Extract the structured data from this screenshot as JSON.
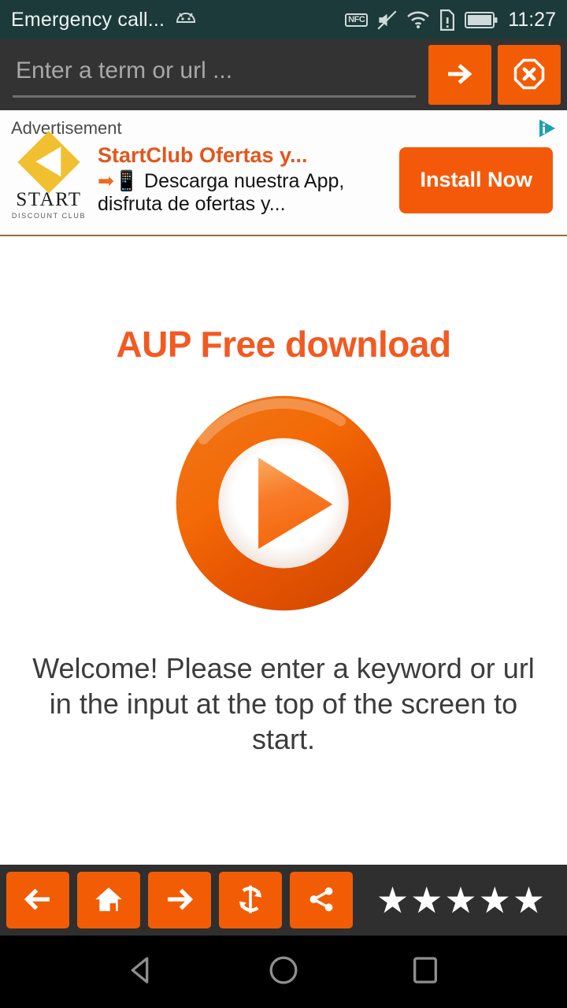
{
  "statusbar": {
    "title": "Emergency call...",
    "android_icon": "android-robot-icon",
    "nfc_label": "NFC",
    "icons": [
      "nfc-icon",
      "mute-icon",
      "wifi-icon",
      "sim-alert-icon",
      "battery-icon"
    ],
    "time": "11:27",
    "background": "#1d3a3a"
  },
  "urlbar": {
    "input_value": "",
    "placeholder": "Enter a term or url ...",
    "go_button": "go-arrow-icon",
    "clear_button": "stop-close-icon",
    "accent": "#f25c05"
  },
  "ad": {
    "label": "Advertisement",
    "adchoices": "adchoices-icon",
    "logo": {
      "brand": "START",
      "sub": "DISCOUNT CLUB",
      "diamond_color": "#f0c030"
    },
    "title": "StartClub Ofertas y...",
    "description_arrow": "➡",
    "description_phone": "📱",
    "description": " Descarga nuestra App, disfruta de ofertas y...",
    "cta_label": "Install Now",
    "cta_color": "#f4590a"
  },
  "main": {
    "title": "AUP Free download",
    "title_color": "#f15a22",
    "logo": "play-button-logo",
    "welcome": "Welcome! Please enter a keyword or url in the input at the top of the screen to start."
  },
  "toolbar": {
    "buttons": [
      {
        "name": "back-button",
        "icon": "arrow-left-icon"
      },
      {
        "name": "home-button",
        "icon": "home-icon"
      },
      {
        "name": "forward-button",
        "icon": "arrow-right-icon"
      },
      {
        "name": "refresh-button",
        "icon": "refresh-icon"
      },
      {
        "name": "share-button",
        "icon": "share-icon"
      }
    ],
    "rating": {
      "stars_total": 5,
      "stars_filled": 5,
      "glyph": "★"
    },
    "background": "#2f2f2f",
    "button_color": "#f25c05"
  },
  "navbar": {
    "back": "nav-back-triangle-icon",
    "home": "nav-home-circle-icon",
    "recents": "nav-recents-square-icon"
  }
}
